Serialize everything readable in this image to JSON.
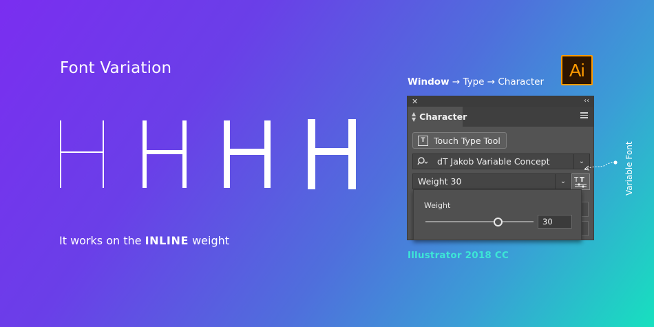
{
  "headline": "Font Variation",
  "glyph_samples": {
    "character": "H",
    "weights": [
      "thin",
      "light",
      "regular",
      "bold"
    ]
  },
  "caption": {
    "prefix": "It works on the ",
    "emphasis": "INLINE",
    "suffix": " weight"
  },
  "breadcrumb": {
    "root": "Window",
    "separator": "→",
    "level1": "Type",
    "level2": "Character"
  },
  "app_logo": {
    "text": "Ai",
    "accent_color": "#ff9a00",
    "background": "#2e1500"
  },
  "panel": {
    "close_glyph": "✕",
    "collapse_glyph": "‹‹",
    "tab_label": "Character",
    "touch_tool_label": "Touch Type Tool",
    "font_family": "dT Jakob Variable Concept",
    "font_style": "Weight 30",
    "dropdown_glyph": "⌄",
    "icons": {
      "close": "close-icon",
      "collapse": "collapse-icon",
      "menu": "hamburger-menu-icon",
      "touch": "touch-type-icon",
      "search": "search-icon",
      "variable": "variable-font-icon"
    }
  },
  "weight_popup": {
    "label": "Weight",
    "value": "30",
    "slider_fraction": 0.67
  },
  "annotation": {
    "label": "Variable Font"
  },
  "footer": "Illustrator 2018 CC",
  "colors": {
    "gradient_start": "#7a2ef0",
    "gradient_end": "#17e0bf",
    "footer_text": "#3de6d6",
    "panel_bg": "#535353"
  }
}
